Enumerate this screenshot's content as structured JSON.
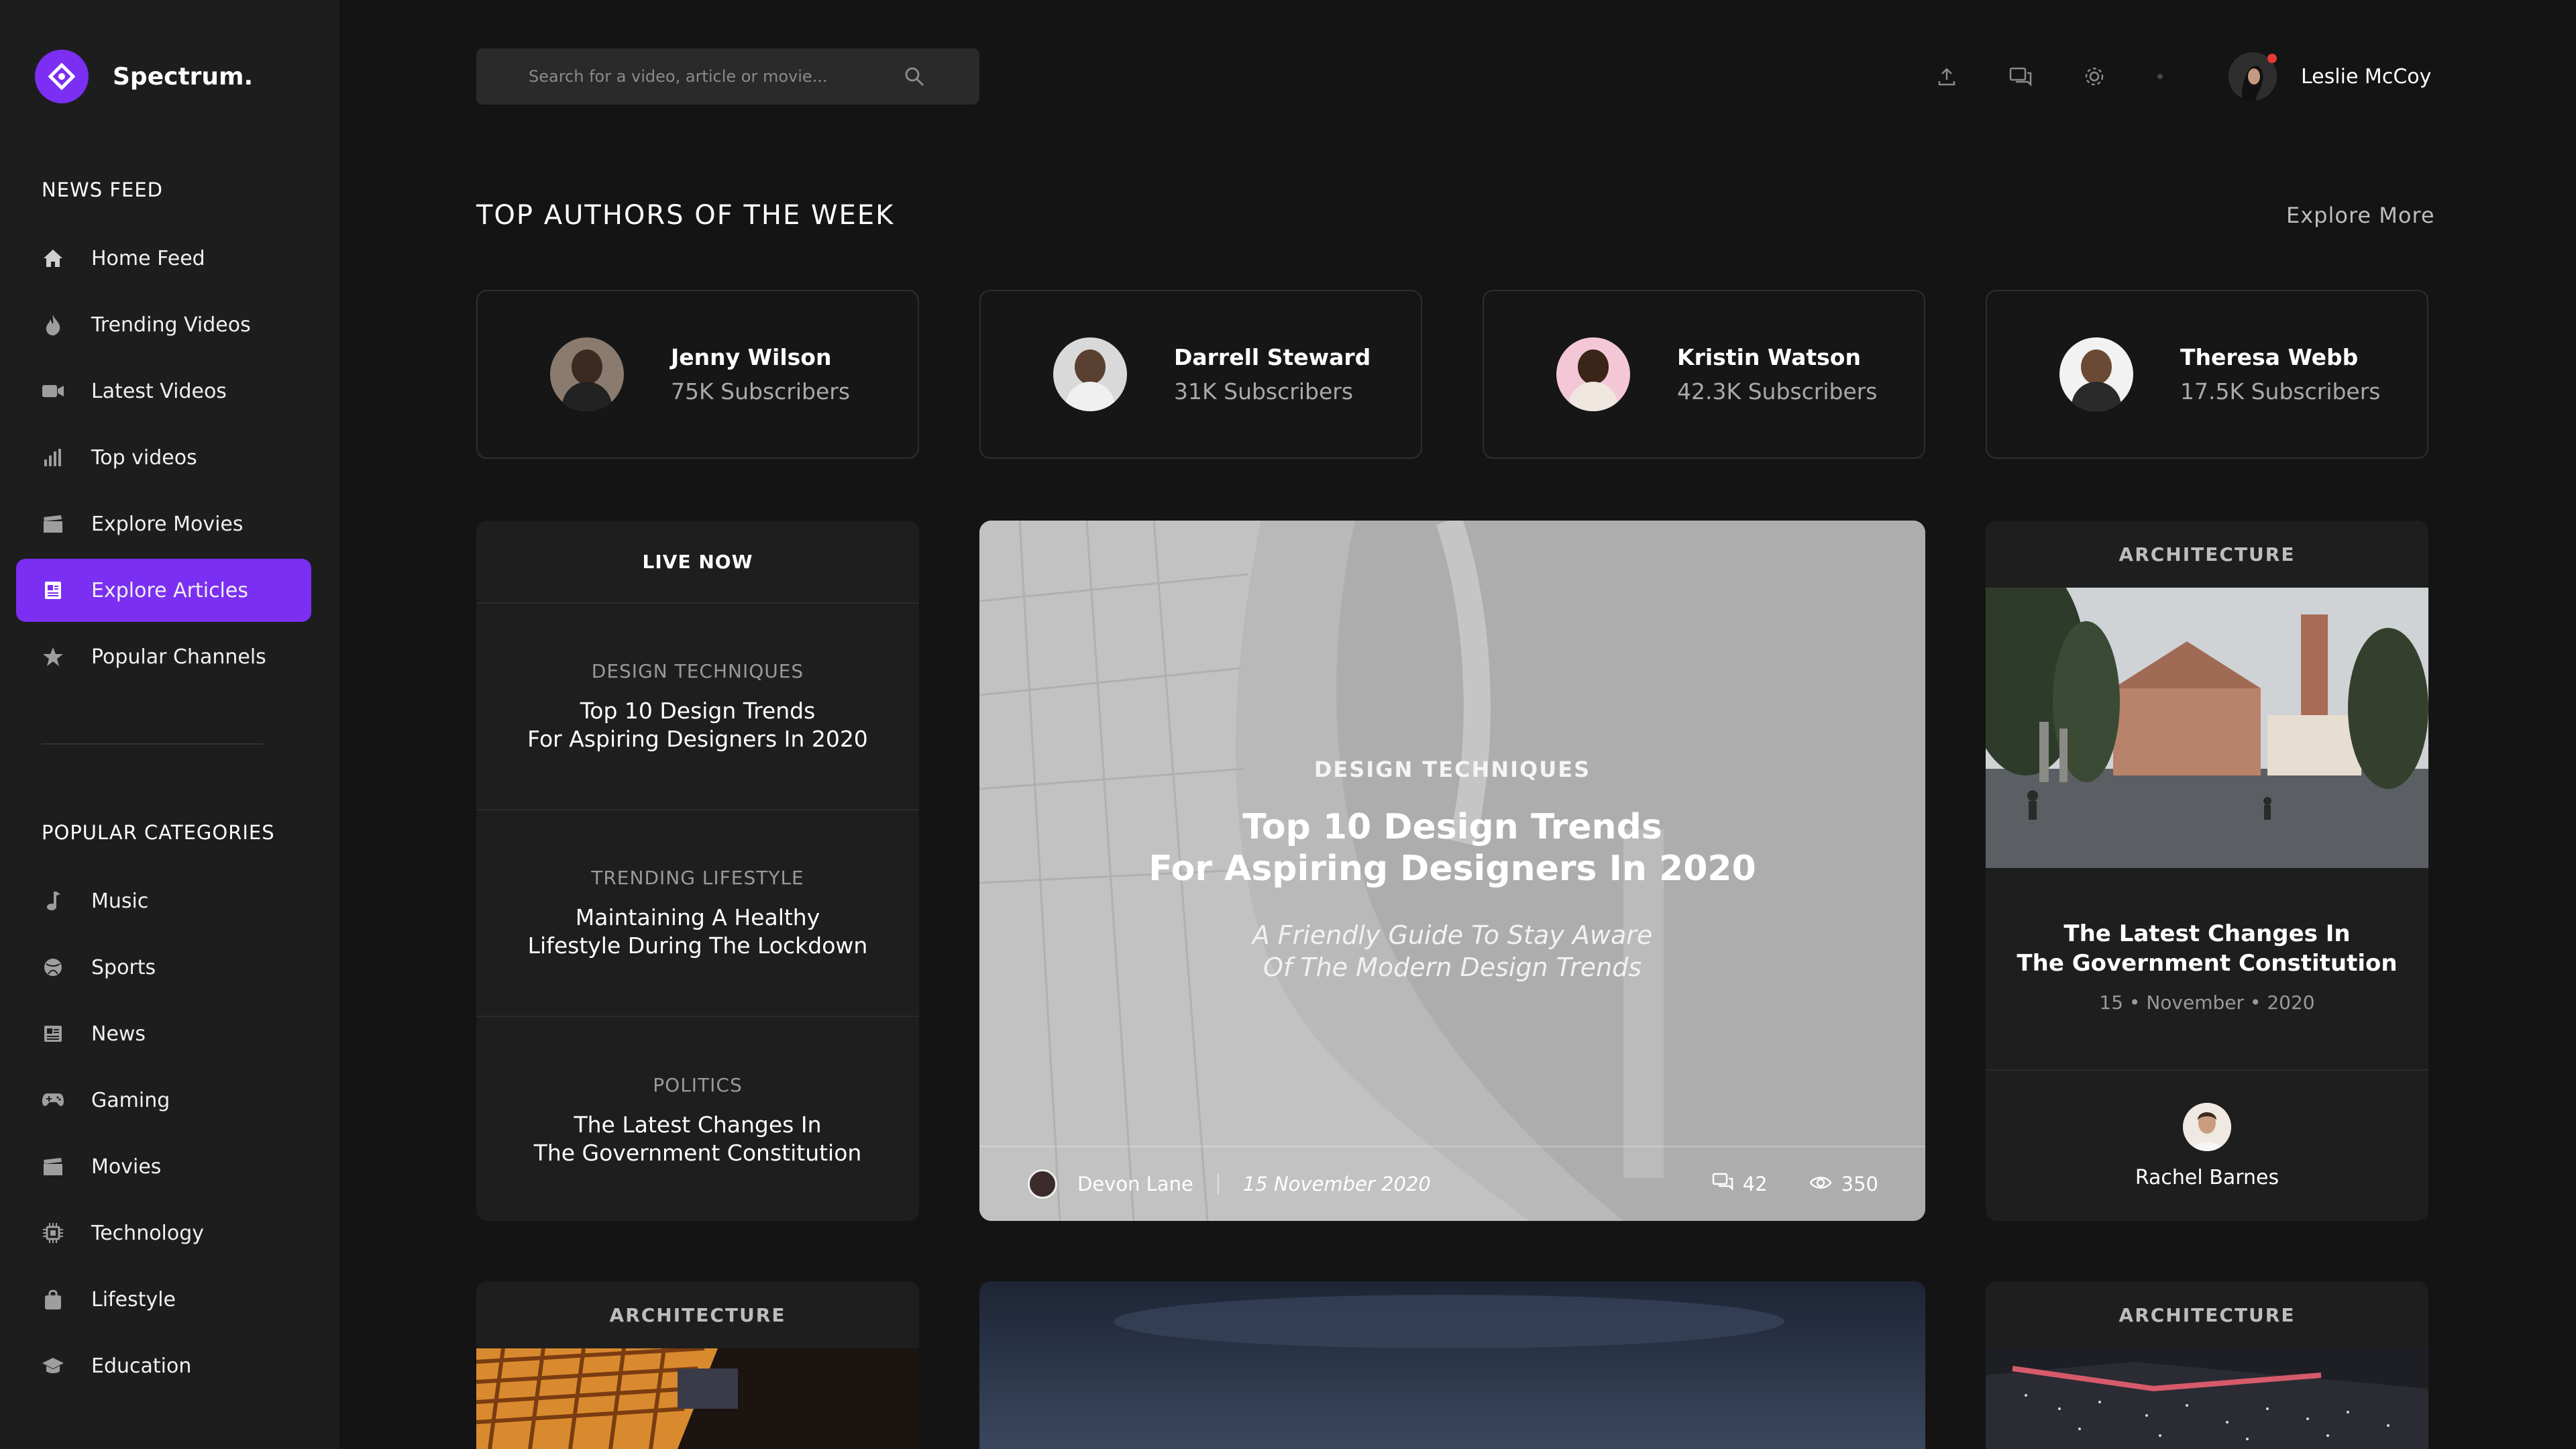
{
  "brand": {
    "name": "Spectrum."
  },
  "sidebar": {
    "news_feed_title": "NEWS FEED",
    "nav": [
      {
        "label": "Home Feed",
        "icon": "home-icon"
      },
      {
        "label": "Trending Videos",
        "icon": "flame-icon"
      },
      {
        "label": "Latest Videos",
        "icon": "video-camera-icon"
      },
      {
        "label": "Top videos",
        "icon": "bar-chart-icon"
      },
      {
        "label": "Explore Movies",
        "icon": "clapperboard-icon"
      },
      {
        "label": "Explore Articles",
        "icon": "article-icon",
        "active": true
      },
      {
        "label": "Popular Channels",
        "icon": "star-icon"
      }
    ],
    "categories_title": "POPULAR CATEGORIES",
    "categories": [
      {
        "label": "Music",
        "icon": "music-note-icon"
      },
      {
        "label": "Sports",
        "icon": "ball-icon"
      },
      {
        "label": "News",
        "icon": "newspaper-icon"
      },
      {
        "label": "Gaming",
        "icon": "gamepad-icon"
      },
      {
        "label": "Movies",
        "icon": "clapperboard-icon"
      },
      {
        "label": "Technology",
        "icon": "chip-icon"
      },
      {
        "label": "Lifestyle",
        "icon": "bag-icon"
      },
      {
        "label": "Education",
        "icon": "graduation-cap-icon"
      }
    ]
  },
  "search": {
    "placeholder": "Search for a video, article or movie..."
  },
  "user": {
    "name": "Leslie McCoy"
  },
  "authors_section": {
    "title": "TOP AUTHORS OF THE WEEK",
    "explore_label": "Explore More",
    "authors": [
      {
        "name": "Jenny Wilson",
        "subscribers": "75K Subscribers"
      },
      {
        "name": "Darrell Steward",
        "subscribers": "31K Subscribers"
      },
      {
        "name": "Kristin Watson",
        "subscribers": "42.3K Subscribers"
      },
      {
        "name": "Theresa Webb",
        "subscribers": "17.5K Subscribers"
      }
    ]
  },
  "live_now": {
    "title": "LIVE NOW",
    "items": [
      {
        "category": "DESIGN TECHNIQUES",
        "line1": "Top 10 Design Trends",
        "line2": "For Aspiring Designers In 2020"
      },
      {
        "category": "TRENDING LIFESTYLE",
        "line1": "Maintaining A Healthy",
        "line2": "Lifestyle During The Lockdown"
      },
      {
        "category": "POLITICS",
        "line1": "The Latest Changes In",
        "line2": "The Government Constitution"
      }
    ]
  },
  "hero": {
    "category": "DESIGN TECHNIQUES",
    "title_line1": "Top 10 Design Trends",
    "title_line2": "For Aspiring Designers In 2020",
    "subtitle_line1": "A Friendly Guide To Stay Aware",
    "subtitle_line2": "Of The Modern Design Trends",
    "author": "Devon Lane",
    "date": "15 November 2020",
    "comments": "42",
    "views": "350"
  },
  "article": {
    "category": "ARCHITECTURE",
    "title_line1": "The Latest Changes In",
    "title_line2": "The Government Constitution",
    "date": "15 • November • 2020",
    "author": "Rachel Barnes"
  },
  "bottom_cards": [
    {
      "category": "ARCHITECTURE"
    },
    {
      "category": ""
    },
    {
      "category": "ARCHITECTURE"
    }
  ],
  "colors": {
    "accent": "#7b2ff2",
    "background": "#141414",
    "sidebar": "#1d1d1d",
    "card": "#1e1e1e"
  }
}
